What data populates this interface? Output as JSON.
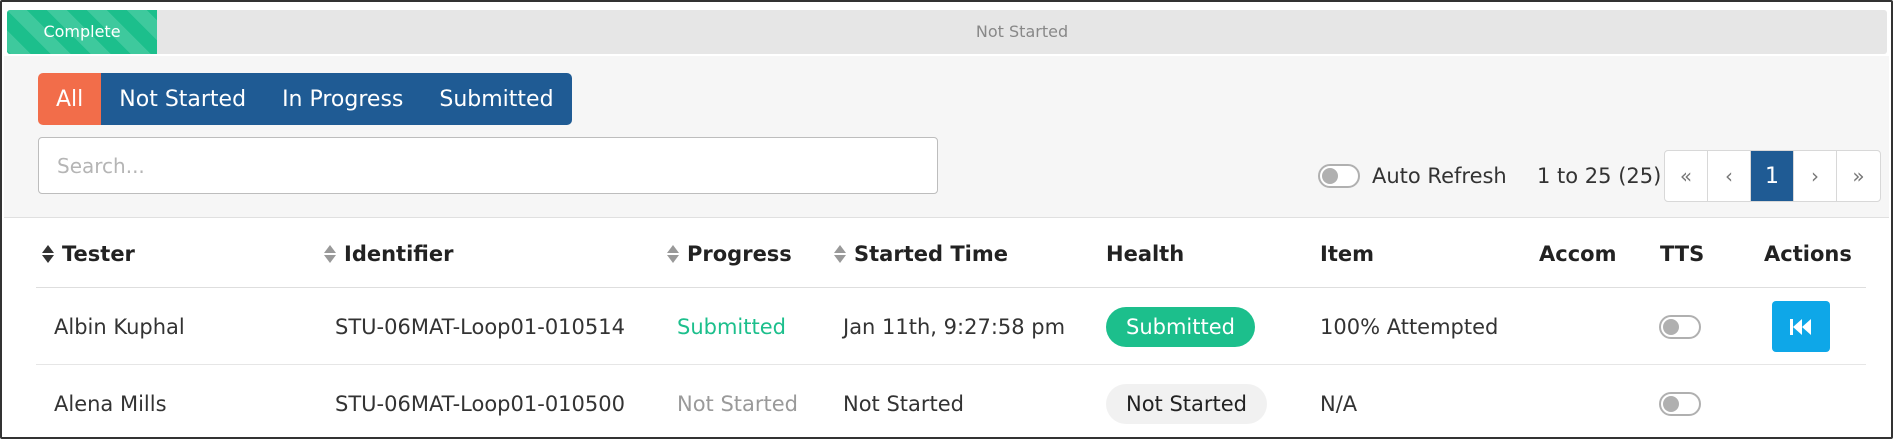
{
  "progress": {
    "complete_label": "Complete",
    "not_started_label": "Not Started",
    "complete_fraction": 0.08,
    "complete_color": "#1cbf8c"
  },
  "filters": {
    "items": [
      "All",
      "Not Started",
      "In Progress",
      "Submitted"
    ],
    "active": "All",
    "active_color": "#f26d4a",
    "inactive_color": "#1f5b94"
  },
  "search": {
    "placeholder": "Search...",
    "value": ""
  },
  "auto_refresh": {
    "label": "Auto Refresh",
    "enabled": false
  },
  "pagination": {
    "range_label": "1 to 25 (25)",
    "first": "«",
    "prev": "‹",
    "current": "1",
    "next": "›",
    "last": "»"
  },
  "table": {
    "headers": {
      "tester": "Tester",
      "identifier": "Identifier",
      "progress": "Progress",
      "started_time": "Started Time",
      "health": "Health",
      "item": "Item",
      "accom": "Accom",
      "tts": "TTS",
      "actions": "Actions"
    },
    "rows": [
      {
        "tester": "Albin Kuphal",
        "identifier": "STU-06MAT-Loop01-010514",
        "progress": "Submitted",
        "started_time": "Jan 11th, 9:27:58 pm",
        "health": "Submitted",
        "item": "100% Attempted",
        "accom": "",
        "tts_enabled": false,
        "action_icon": "rewind-icon"
      },
      {
        "tester": "Alena Mills",
        "identifier": "STU-06MAT-Loop01-010500",
        "progress": "Not Started",
        "started_time": "Not Started",
        "health": "Not Started",
        "item": "N/A",
        "accom": "",
        "tts_enabled": false,
        "action_icon": ""
      }
    ]
  }
}
